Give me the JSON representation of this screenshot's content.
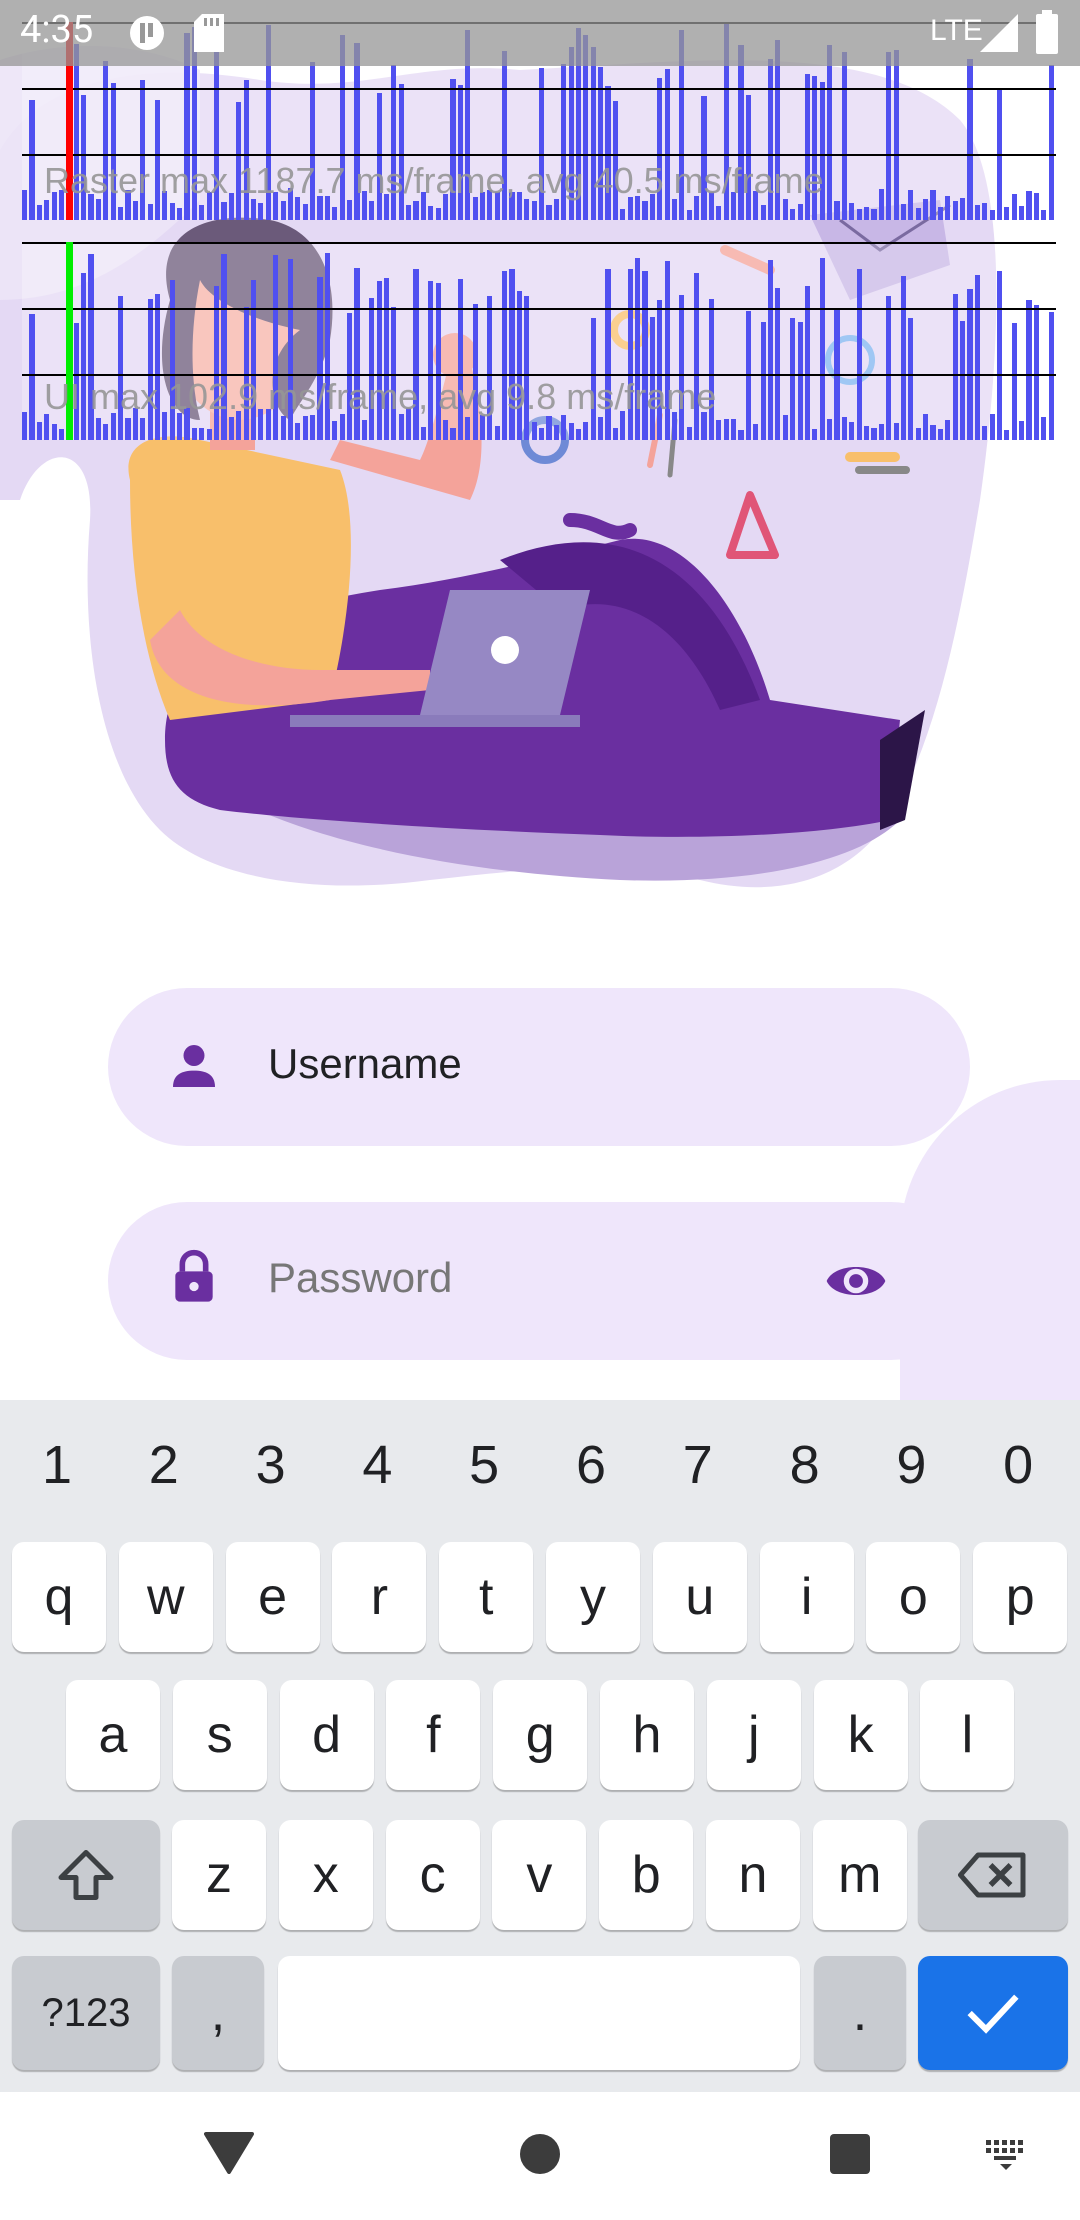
{
  "status_bar": {
    "time": "4:35",
    "network": "LTE"
  },
  "perf_overlay": {
    "raster_text": "Raster  max 1187.7 ms/frame, avg 40.5 ms/frame",
    "ui_text": "UI  max 102.9 ms/frame, avg 9.8 ms/frame",
    "raster_marker_color": "#ff0000",
    "ui_marker_color": "#00ee00",
    "bar_color": "#5050f0"
  },
  "illustration": {
    "name": "person-with-laptop-illustration",
    "accent": "#6c35a4",
    "blob": "#e2d6f3"
  },
  "form": {
    "username_value": "Username",
    "password_placeholder": "Password",
    "field_bg": "#efe6fb",
    "icon_color": "#6a2fa0"
  },
  "keyboard": {
    "number_row": [
      "1",
      "2",
      "3",
      "4",
      "5",
      "6",
      "7",
      "8",
      "9",
      "0"
    ],
    "row1": [
      "q",
      "w",
      "e",
      "r",
      "t",
      "y",
      "u",
      "i",
      "o",
      "p"
    ],
    "row2": [
      "a",
      "s",
      "d",
      "f",
      "g",
      "h",
      "j",
      "k",
      "l"
    ],
    "row3": [
      "z",
      "x",
      "c",
      "v",
      "b",
      "n",
      "m"
    ],
    "symbols_label": "?123",
    "comma": ",",
    "period": ".",
    "enter_color": "#1a73e8"
  },
  "nav": {
    "back": "back-icon",
    "home": "home-icon",
    "recents": "recents-icon",
    "keyboard": "keyboard-switch-icon"
  }
}
